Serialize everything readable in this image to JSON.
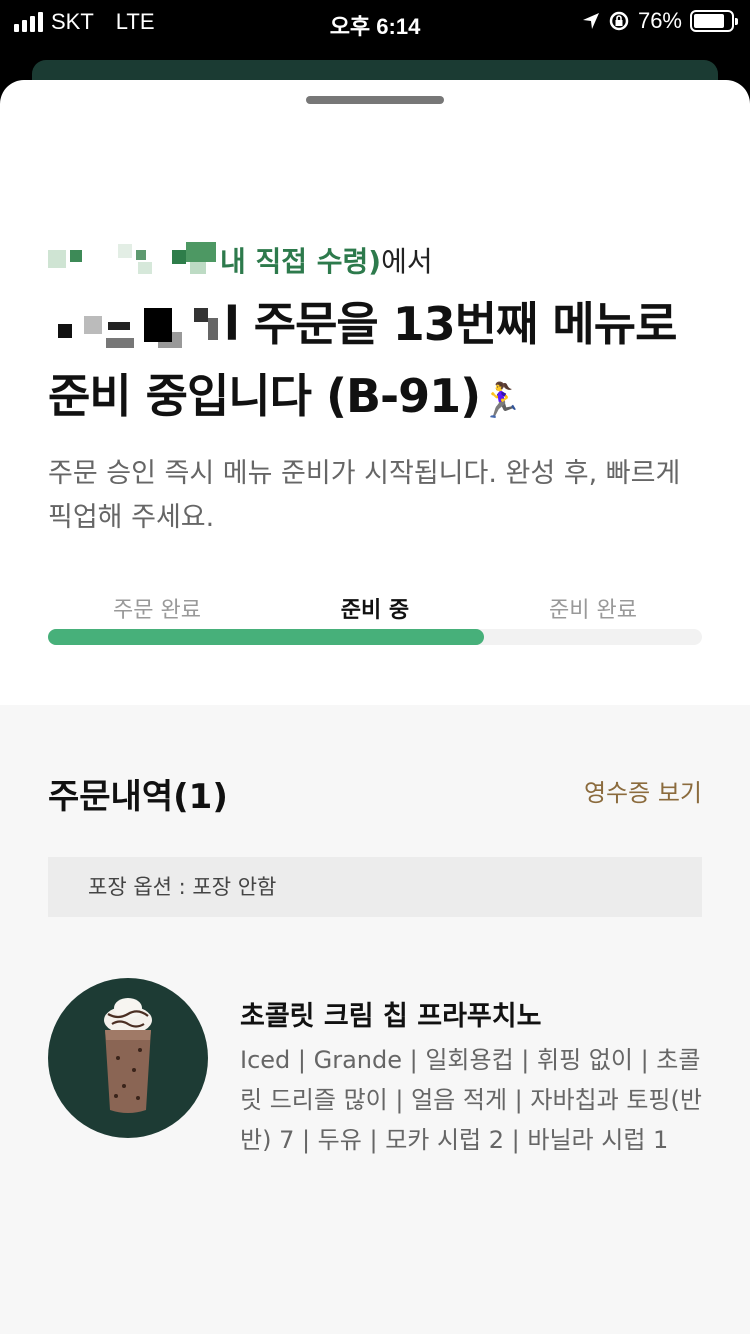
{
  "status_bar": {
    "carrier": "SKT",
    "network": "LTE",
    "time": "오후 6:14",
    "battery": "76%",
    "battery_level": 0.76
  },
  "order": {
    "store_suffix": "내 직접 수령)",
    "store_suffix_after": "에서",
    "title_rest": "l 주문을 13번째 메뉴로 준비 중입니다 (B-91)",
    "runner_emoji": "🏃‍♀️",
    "description": "주문 승인 즉시 메뉴 준비가 시작됩니다. 완성 후, 빠르게 픽업해 주세요.",
    "steps": [
      "주문 완료",
      "준비 중",
      "준비 완료"
    ],
    "progress": 0.667
  },
  "history": {
    "title": "주문내역(1)",
    "receipt_link": "영수증 보기",
    "packaging": "포장 옵션 : 포장 안함",
    "item": {
      "name": "초콜릿 크림 칩 프라푸치노",
      "options": "Iced | Grande | 일회용컵 | 휘핑 없이 | 초콜릿 드리즐 많이 | 얼음 적게 | 자바칩과 토핑(반반) 7 | 두유 | 모카 시럽 2 | 바닐라 시럽 1"
    }
  },
  "colors": {
    "accent_green": "#47b07a",
    "brand_dark": "#1d3b34",
    "receipt_brown": "#8b6b3d"
  }
}
